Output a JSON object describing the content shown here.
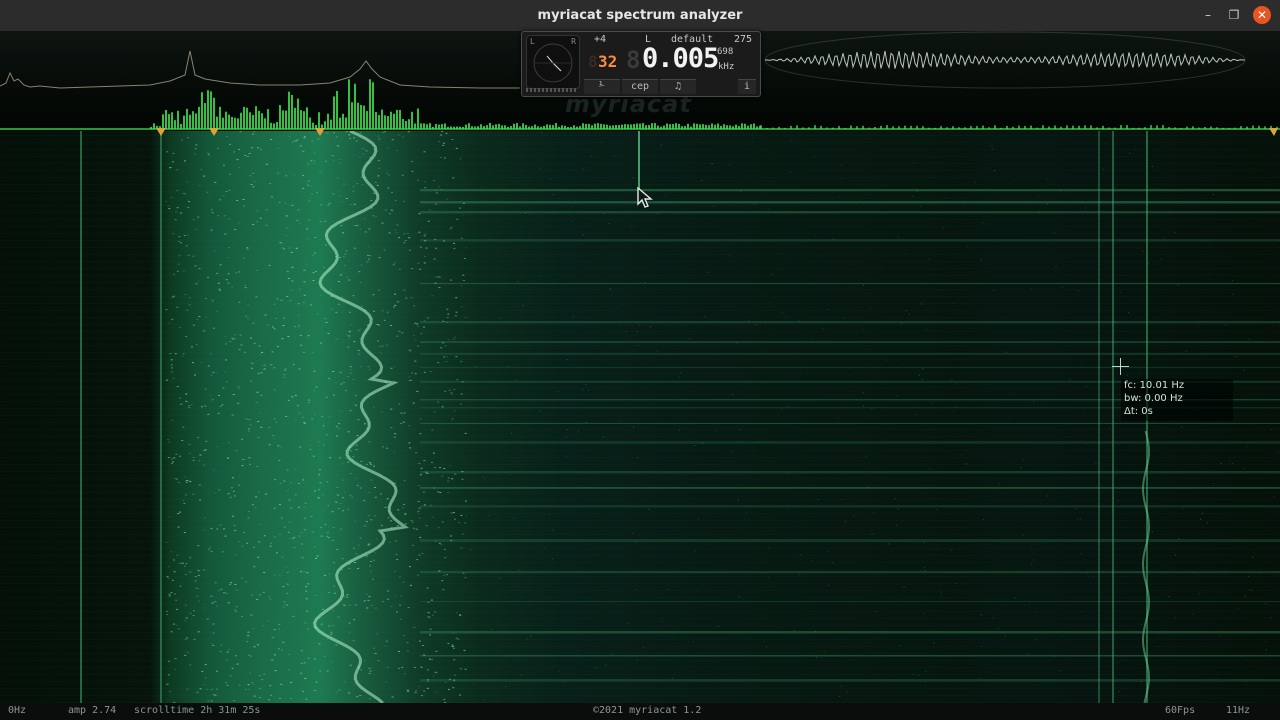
{
  "window": {
    "title": "myriacat spectrum analyzer",
    "minimize_glyph": "–",
    "maximize_glyph": "❐",
    "close_glyph": "✕"
  },
  "panel": {
    "meter_left": "L",
    "meter_right": "R",
    "offset": "+4",
    "channel": "L",
    "preset": "default",
    "value_top": "275",
    "value_sub": "698",
    "unit": "kHz",
    "bit_depth": "32",
    "frequency": "0.005",
    "buttons": {
      "scale": "⅟",
      "cep": "cep",
      "note": "♫",
      "info": "i"
    }
  },
  "watermark": "myriacat",
  "readout": {
    "fc": "fc: 10.01 Hz",
    "bw": "bw: 0.00 Hz",
    "dt": "Δt: 0s"
  },
  "status": {
    "min_freq": "0Hz",
    "amp": "amp 2.74",
    "scrolltime": "scrolltime 2h 31m 25s",
    "copyright": "©2021 myriacat 1.2",
    "fps": "60Fps",
    "max_freq": "11Hz"
  },
  "colors": {
    "accent_green": "#39e64a",
    "marker": "#d9a53a",
    "digits_orange": "#ff8a3c",
    "close_button": "#e95420"
  }
}
